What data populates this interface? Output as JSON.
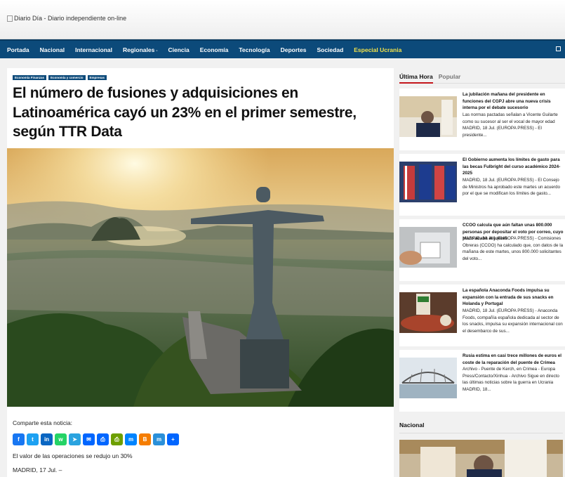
{
  "site": {
    "logo_alt": "Diario Día - Diario independiente on-line"
  },
  "nav": {
    "items": [
      "Portada",
      "Nacional",
      "Internacional",
      "Regionales",
      "Ciencia",
      "Economía",
      "Tecnología",
      "Deportes",
      "Sociedad"
    ],
    "special": "Especial Ucrania"
  },
  "article": {
    "tags": [
      "Economía Finanzas",
      "Economía y comercio",
      "Empresas"
    ],
    "headline": "El número de fusiones y adquisiciones en Latinoamérica cayó un 23% en el primer semestre, según TTR Data",
    "share_label": "Comparte esta noticia:",
    "share_icons": [
      {
        "name": "facebook-icon",
        "color": "#1877f2",
        "glyph": "f"
      },
      {
        "name": "twitter-icon",
        "color": "#1da1f2",
        "glyph": "t"
      },
      {
        "name": "linkedin-icon",
        "color": "#0a66c2",
        "glyph": "in"
      },
      {
        "name": "whatsapp-icon",
        "color": "#25d366",
        "glyph": "w"
      },
      {
        "name": "telegram-icon",
        "color": "#2aa3df",
        "glyph": "➤"
      },
      {
        "name": "email-icon",
        "color": "#0166ff",
        "glyph": "✉"
      },
      {
        "name": "print-icon",
        "color": "#0166ff",
        "glyph": "⎙"
      },
      {
        "name": "printfriendly-icon",
        "color": "#6d9f00",
        "glyph": "⎙"
      },
      {
        "name": "messenger-icon",
        "color": "#0084ff",
        "glyph": "m"
      },
      {
        "name": "blogger-icon",
        "color": "#f57d00",
        "glyph": "B"
      },
      {
        "name": "mastodon-icon",
        "color": "#2b90d9",
        "glyph": "m"
      },
      {
        "name": "share-plus-icon",
        "color": "#0166ff",
        "glyph": "+"
      }
    ],
    "lead": "El valor de las operaciones se redujo un 30%",
    "dateline": "MADRID, 17 Jul. –"
  },
  "sidebar": {
    "tabs": [
      "Última Hora",
      "Popular"
    ],
    "cards": [
      {
        "title": "La jubilación mañana del presidente en funciones del CGPJ abre una nueva crisis interna por el debate sucesorio",
        "excerpt": "Las normas pactadas señalan a Vicente Guilarte como su sucesor al ser el vocal de mayor edad MADRID, 18 Jul. (EUROPA PRESS) - El presidente..."
      },
      {
        "title": "El Gobierno aumenta los límites de gasto para las becas Fulbright del curso académico 2024-2025",
        "excerpt": "MADRID, 18 Jul. (EUROPA PRESS) - El Consejo de Ministros ha aprobado este martes un acuerdo por el que se modifican los límites de gasto..."
      },
      {
        "title": "CCOO calcula que aún faltan unas 800.000 personas por depositar el voto por correo, cuyo plazo acaba el jueves",
        "excerpt": "MADRID, 18 Jul. (EUROPA PRESS) - Comisiones Obreras (CCOO) ha calculado que, con datos de la mañana de este martes, unos 800.000 solicitantes del voto..."
      },
      {
        "title": "La española Anaconda Foods impulsa su expansión con la entrada de sus snacks en Holanda y Portugal",
        "excerpt": "MADRID, 18 Jul. (EUROPA PRESS) - Anaconda Foods, compañía española dedicada al sector de los snacks, impulsa su expansión internacional con el desembarco de sus..."
      },
      {
        "title": "Rusia estima en casi trece millones de euros el coste de la reparación del puente de Crimea",
        "excerpt": "Archivo - Puente de Kerch, en Crimea - Europa Press/Contacto/Xinhua - Archivo Sigue en directo las últimas noticias sobre la guerra en Ucrania MADRID, 18..."
      }
    ],
    "section_title": "Nacional"
  }
}
